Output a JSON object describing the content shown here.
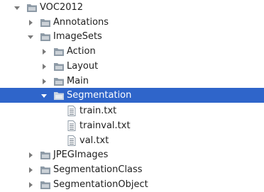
{
  "tree": {
    "root": {
      "label": "VOC2012",
      "expanded": true
    },
    "items": [
      {
        "label": "Annotations",
        "expanded": false,
        "type": "folder"
      },
      {
        "label": "ImageSets",
        "expanded": true,
        "type": "folder"
      },
      {
        "label": "Action",
        "expanded": false,
        "type": "folder"
      },
      {
        "label": "Layout",
        "expanded": false,
        "type": "folder"
      },
      {
        "label": "Main",
        "expanded": false,
        "type": "folder"
      },
      {
        "label": "Segmentation",
        "expanded": true,
        "type": "folder",
        "selected": true
      },
      {
        "label": "train.txt",
        "type": "file"
      },
      {
        "label": "trainval.txt",
        "type": "file"
      },
      {
        "label": "val.txt",
        "type": "file"
      },
      {
        "label": "JPEGImages",
        "expanded": false,
        "type": "folder"
      },
      {
        "label": "SegmentationClass",
        "expanded": false,
        "type": "folder"
      },
      {
        "label": "SegmentationObject",
        "expanded": false,
        "type": "folder"
      }
    ]
  },
  "colors": {
    "selection": "#2f65ca",
    "folder": "#8d9aa6",
    "arrow": "#7a7a7a",
    "text": "#1f1f1f"
  }
}
